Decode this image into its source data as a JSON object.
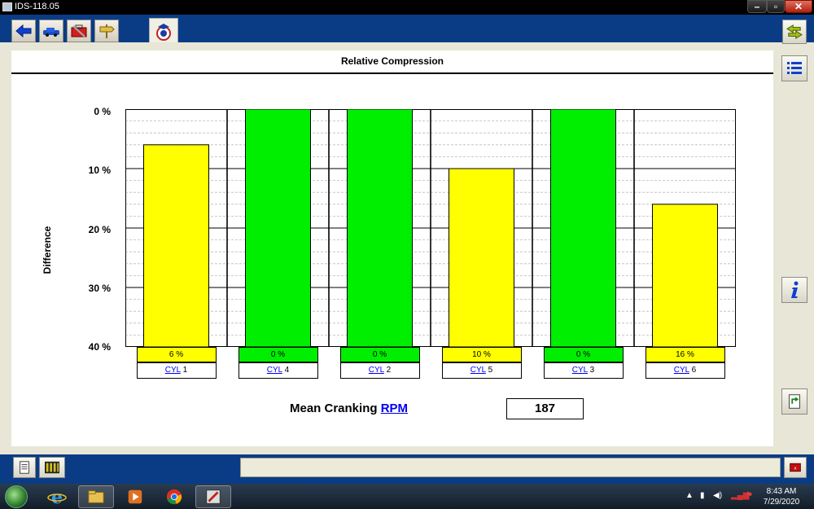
{
  "window": {
    "title": "IDS-118.05",
    "controls": [
      "minimize",
      "maximize",
      "close"
    ]
  },
  "toolbar": {
    "tabs": [
      {
        "icon": "blue-arrow-icon"
      },
      {
        "icon": "vehicle-icon"
      },
      {
        "icon": "toolbox-icon"
      },
      {
        "icon": "signpost-icon"
      },
      {
        "icon": "diagnostic-badge-icon"
      }
    ]
  },
  "panel": {
    "title": "Relative Compression"
  },
  "chart_data": {
    "type": "bar",
    "title": "Relative Compression",
    "ylabel": "Difference",
    "ylim": [
      0,
      40
    ],
    "y_inverted": true,
    "yticks": [
      "0 %",
      "10 %",
      "20 %",
      "30 %",
      "40 %"
    ],
    "categories": [
      "CYL 1",
      "CYL 4",
      "CYL 2",
      "CYL 5",
      "CYL 3",
      "CYL 6"
    ],
    "series": [
      {
        "values": [
          6,
          0,
          0,
          10,
          0,
          16
        ],
        "labels": [
          "6 %",
          "0 %",
          "0 %",
          "10 %",
          "0 %",
          "16 %"
        ],
        "colors": [
          "#ffff00",
          "#00ee00",
          "#00ee00",
          "#ffff00",
          "#00ee00",
          "#ffff00"
        ]
      }
    ],
    "grid": true
  },
  "cylinders": [
    {
      "link": "CYL",
      "num": "1"
    },
    {
      "link": "CYL",
      "num": "4"
    },
    {
      "link": "CYL",
      "num": "2"
    },
    {
      "link": "CYL",
      "num": "5"
    },
    {
      "link": "CYL",
      "num": "3"
    },
    {
      "link": "CYL",
      "num": "6"
    }
  ],
  "rpm": {
    "label": "Mean Cranking",
    "link": "RPM",
    "value": "187"
  },
  "right_panel": {
    "icons": [
      "swap-arrows-icon",
      "list-icon",
      "info-icon",
      "export-icon"
    ]
  },
  "bottom": {
    "icons": [
      "notes-icon",
      "battery-pack-icon",
      "stop-icon"
    ]
  },
  "taskbar": {
    "apps": [
      "internet-explorer-icon",
      "file-explorer-icon",
      "media-player-icon",
      "chrome-icon",
      "ids-app-icon"
    ],
    "clock": {
      "time": "8:43 AM",
      "date": "7/29/2020"
    }
  },
  "colors": {
    "accent": "#0a3c86",
    "pass": "#00ee00",
    "warn": "#ffff00"
  }
}
